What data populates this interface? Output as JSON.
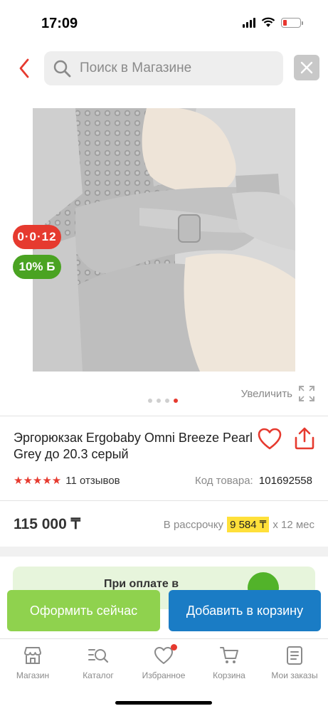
{
  "status_bar": {
    "time": "17:09"
  },
  "search": {
    "placeholder": "Поиск в Магазине"
  },
  "badges": {
    "timer": "0·0·12",
    "bonus": "10% Б"
  },
  "gallery": {
    "zoom_label": "Увеличить",
    "total_images": 4,
    "active_index": 3
  },
  "product": {
    "title": "Эргорюкзак Ergobaby Omni Breeze Pearl Grey до 20.3 серый",
    "reviews": "11 отзывов",
    "rating": 5,
    "sku_label": "Код товара:",
    "sku_value": "101692558",
    "price": "115 000 ₸",
    "installment_label": "В рассрочку",
    "installment_amount": "9 584 ₸",
    "installment_term": "х 12 мес"
  },
  "promo": {
    "text": "При оплате в"
  },
  "actions": {
    "buy_now": "Оформить сейчас",
    "add_to_cart": "Добавить в корзину"
  },
  "nav": [
    {
      "label": "Магазин",
      "icon": "store-icon"
    },
    {
      "label": "Каталог",
      "icon": "catalog-search-icon"
    },
    {
      "label": "Избранное",
      "icon": "heart-icon"
    },
    {
      "label": "Корзина",
      "icon": "cart-icon"
    },
    {
      "label": "Мои заказы",
      "icon": "orders-icon"
    }
  ],
  "colors": {
    "accent_red": "#e63a2f",
    "green": "#8fd24e",
    "blue": "#1a7cc5"
  }
}
